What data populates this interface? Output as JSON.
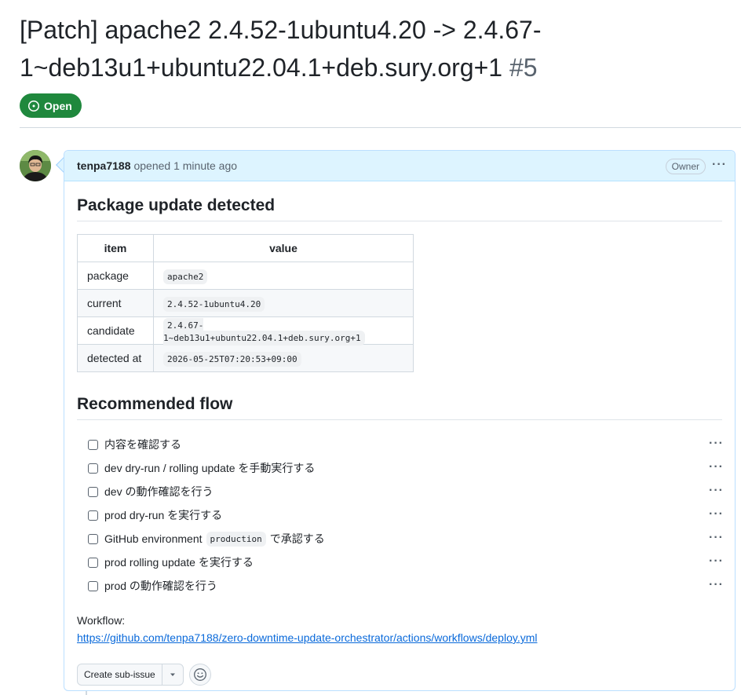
{
  "issue": {
    "title": "[Patch] apache2 2.4.52-1ubuntu4.20 -> 2.4.67-1~deb13u1+ubuntu22.04.1+deb.sury.org+1",
    "number": "#5",
    "state": "Open"
  },
  "comment": {
    "author": "tenpa7188",
    "meta": "opened 1 minute ago",
    "role": "Owner",
    "heading1": "Package update detected",
    "table": {
      "headers": [
        "item",
        "value"
      ],
      "rows": [
        {
          "item": "package",
          "value": "apache2"
        },
        {
          "item": "current",
          "value": "2.4.52-1ubuntu4.20"
        },
        {
          "item": "candidate",
          "value": "2.4.67-1~deb13u1+ubuntu22.04.1+deb.sury.org+1"
        },
        {
          "item": "detected at",
          "value": "2026-05-25T07:20:53+09:00"
        }
      ]
    },
    "heading2": "Recommended flow",
    "tasks": [
      {
        "text": "内容を確認する"
      },
      {
        "text": "dev dry-run / rolling update を手動実行する"
      },
      {
        "text": "dev の動作確認を行う"
      },
      {
        "text": "prod dry-run を実行する"
      },
      {
        "pre": "GitHub environment",
        "code": "production",
        "post": "で承認する"
      },
      {
        "text": "prod rolling update を実行する"
      },
      {
        "text": "prod の動作確認を行う"
      }
    ],
    "workflow_label": "Workflow:",
    "workflow_url": "https://github.com/tenpa7188/zero-downtime-update-orchestrator/actions/workflows/deploy.yml"
  },
  "actions": {
    "create_sub_issue": "Create sub-issue"
  },
  "colors": {
    "open_badge": "#1f883d",
    "header_bg": "#ddf4ff",
    "link": "#0969da"
  }
}
